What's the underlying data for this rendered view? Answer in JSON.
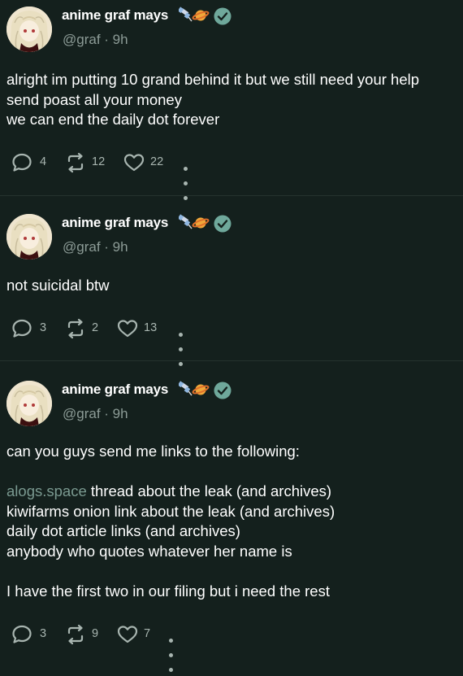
{
  "posts": [
    {
      "author": "anime graf mays",
      "handle": "@graf · 9h",
      "lines": [
        "alright im putting 10 grand behind it but we still need your help",
        "send poast all your money",
        "we can end the daily dot forever"
      ],
      "replies": "4",
      "reposts": "12",
      "likes": "22"
    },
    {
      "author": "anime graf mays",
      "handle": "@graf · 9h",
      "lines": [
        "not suicidal btw"
      ],
      "replies": "3",
      "reposts": "2",
      "likes": "13"
    },
    {
      "author": "anime graf mays",
      "handle": "@graf · 9h",
      "intro": "can you guys send me links to the following:",
      "link_text": "alogs.space",
      "line_after_link": " thread about the leak (and archives)",
      "lines": [
        "kiwifarms onion link about the leak (and archives)",
        "daily dot article links (and archives)",
        "anybody who quotes whatever her name is"
      ],
      "closing": "I have the first two in our filing but i need the rest",
      "replies": "3",
      "reposts": "9",
      "likes": "7"
    }
  ],
  "icons": {
    "reply": "speech-bubble-icon",
    "repost": "repost-arrows-icon",
    "like": "heart-icon",
    "more": "ellipsis-icon",
    "verified": "verified-check-icon",
    "emoji": "satellite-planet-emoji-icon"
  },
  "colors": {
    "background": "#14201d",
    "muted": "#8c9b96",
    "link": "#7a9990",
    "verified": "#6fa89b"
  }
}
